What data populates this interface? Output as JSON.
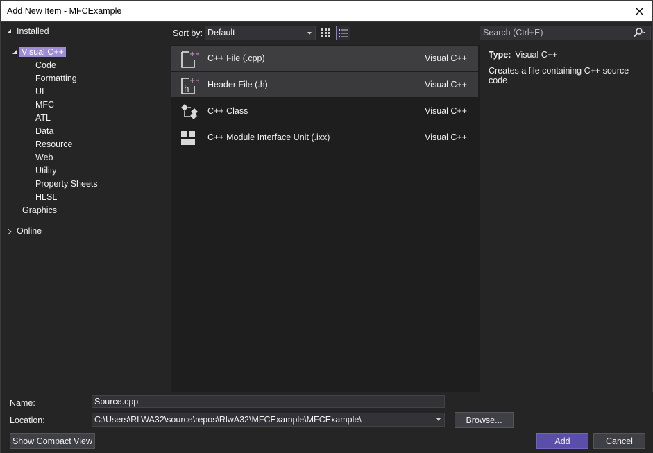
{
  "window": {
    "title": "Add New Item - MFCExample"
  },
  "tree": {
    "installed": "Installed",
    "visual_cpp": "Visual C++",
    "children": [
      "Code",
      "Formatting",
      "UI",
      "MFC",
      "ATL",
      "Data",
      "Resource",
      "Web",
      "Utility",
      "Property Sheets",
      "HLSL"
    ],
    "graphics": "Graphics",
    "online": "Online"
  },
  "toolbar": {
    "sort_label": "Sort by:",
    "sort_value": "Default",
    "search_placeholder": "Search (Ctrl+E)"
  },
  "templates": [
    {
      "name": "C++ File (.cpp)",
      "lang": "Visual C++",
      "icon": "cpp-file-icon"
    },
    {
      "name": "Header File (.h)",
      "lang": "Visual C++",
      "icon": "header-file-icon"
    },
    {
      "name": "C++ Class",
      "lang": "Visual C++",
      "icon": "class-icon"
    },
    {
      "name": "C++ Module Interface Unit (.ixx)",
      "lang": "Visual C++",
      "icon": "module-icon"
    }
  ],
  "details": {
    "type_label": "Type:",
    "type_value": "Visual C++",
    "description": "Creates a file containing C++ source code"
  },
  "form": {
    "name_label": "Name:",
    "name_value": "Source.cpp",
    "location_label": "Location:",
    "location_value": "C:\\Users\\RLWA32\\source\\repos\\RlwA32\\MFCExample\\MFCExample\\",
    "browse_label": "Browse...",
    "compact_label": "Show Compact View",
    "add_label": "Add",
    "cancel_label": "Cancel"
  },
  "colors": {
    "accent": "#9e8cd6",
    "primary_button": "#5b4ea8",
    "background": "#252526"
  }
}
